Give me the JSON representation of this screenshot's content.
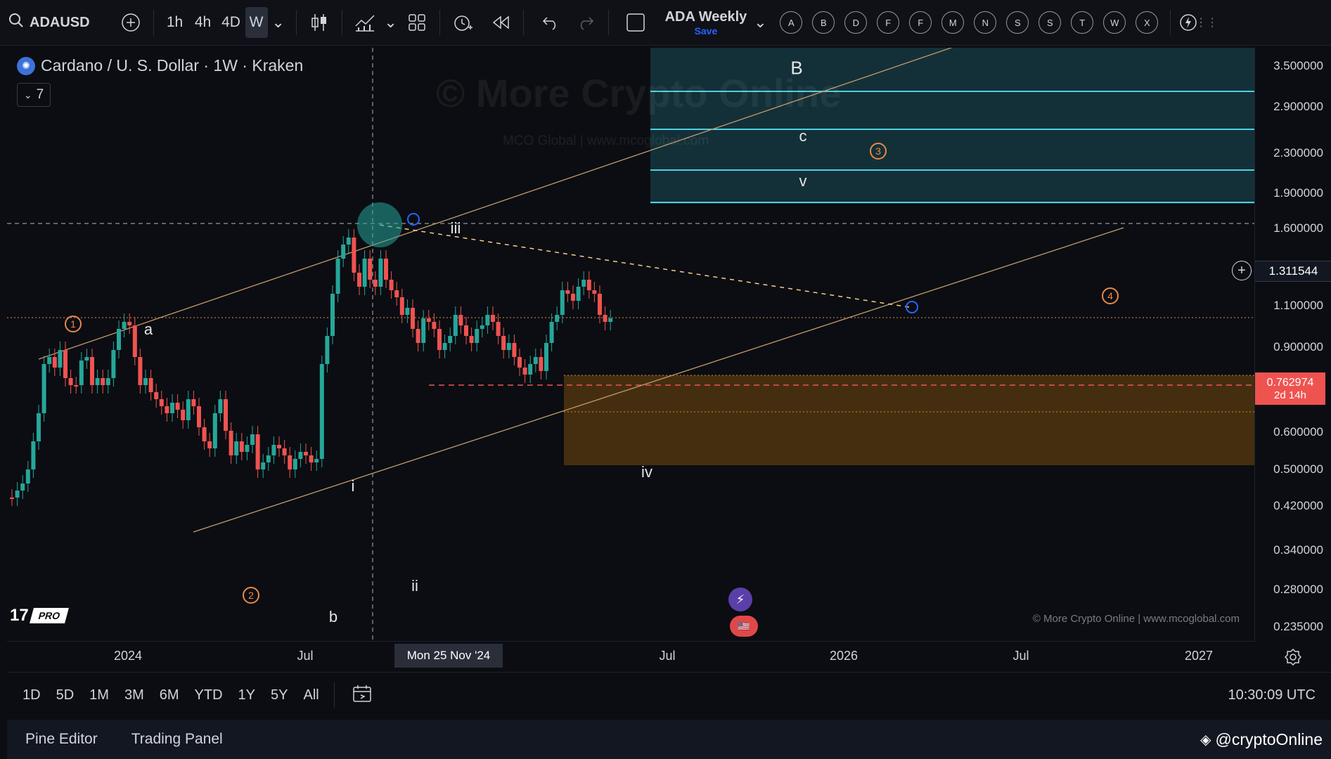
{
  "toolbar": {
    "symbol": "ADAUSD",
    "timeframes": [
      "1h",
      "4h",
      "4D",
      "W"
    ],
    "active_timeframe": "W",
    "layout_name": "ADA Weekly",
    "save_label": "Save",
    "drawing_letters": [
      "A",
      "B",
      "D",
      "F",
      "F",
      "M",
      "N",
      "S",
      "S",
      "T",
      "W",
      "X"
    ]
  },
  "legend": {
    "title": "Cardano / U. S. Dollar · 1W · Kraken",
    "indicator_count": "7"
  },
  "watermark": {
    "title": "© More Crypto Online",
    "subtitle": "MCO Global   |   www.mcoglobal.com"
  },
  "copyright": "© More Crypto Online   |   www.mcoglobal.com",
  "price_axis": {
    "labels": [
      "3.500000",
      "2.900000",
      "2.300000",
      "1.900000",
      "1.600000",
      "1.100000",
      "0.900000",
      "0.600000",
      "0.500000",
      "0.420000",
      "0.340000",
      "0.280000",
      "0.235000"
    ],
    "crosshair_price": "1.311544",
    "last_price": "0.762974",
    "countdown": "2d 14h"
  },
  "time_axis": {
    "labels": [
      "2024",
      "Jul",
      "Jul",
      "2026",
      "Jul",
      "2027"
    ],
    "crosshair_date": "Mon 25 Nov '24"
  },
  "wave_labels": {
    "B": "B",
    "c": "c",
    "v": "v",
    "iii": "iii",
    "a": "a",
    "i": "i",
    "ii": "ii",
    "b": "b",
    "iv": "iv",
    "circled": [
      "1",
      "2",
      "3",
      "4"
    ]
  },
  "bottom": {
    "ranges": [
      "1D",
      "5D",
      "1M",
      "3M",
      "6M",
      "YTD",
      "1Y",
      "5Y",
      "All"
    ],
    "clock": "10:30:09 UTC"
  },
  "footer": {
    "tabs": [
      "Pine Editor",
      "Trading Panel"
    ],
    "handle": "@cryptoOnline"
  },
  "colors": {
    "up": "#26a69a",
    "down": "#ef5350",
    "fib_zone": "#1b4e57",
    "support_zone": "#5a3a0f",
    "channel": "#c49a6c",
    "last_price_bg": "#ef5350"
  }
}
